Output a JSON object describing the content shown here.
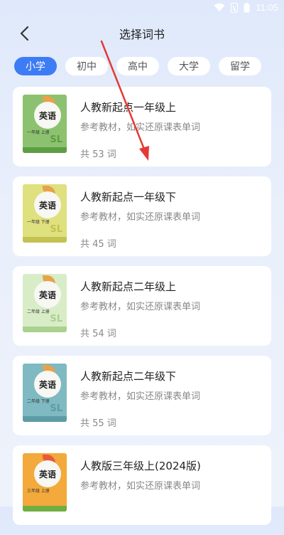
{
  "status_bar": {
    "time": "11:05"
  },
  "header": {
    "title": "选择词书"
  },
  "tabs": [
    {
      "label": "小学",
      "active": true
    },
    {
      "label": "初中",
      "active": false
    },
    {
      "label": "高中",
      "active": false
    },
    {
      "label": "大学",
      "active": false
    },
    {
      "label": "留学",
      "active": false
    }
  ],
  "books": [
    {
      "name": "人教新起点一年级上",
      "desc": "参考教材，如实还原课表单词",
      "count": "共 53 词",
      "cover_label": "英语",
      "cover_grade": "一年级 上册",
      "cover_sl": "SL",
      "cover_color": "#8cc26f",
      "cover_band": "#5d9e43",
      "cover_leaf": "#e8a24a"
    },
    {
      "name": "人教新起点一年级下",
      "desc": "参考教材，如实还原课表单词",
      "count": "共 45 词",
      "cover_label": "英语",
      "cover_grade": "一年级 下册",
      "cover_sl": "SL",
      "cover_color": "#dfe07e",
      "cover_band": "#c4c251",
      "cover_leaf": "#e8a24a"
    },
    {
      "name": "人教新起点二年级上",
      "desc": "参考教材，如实还原课表单词",
      "count": "共 54 词",
      "cover_label": "英语",
      "cover_grade": "二年级 上册",
      "cover_sl": "SL",
      "cover_color": "#d8edc7",
      "cover_band": "#a9d18f",
      "cover_leaf": "#e8a24a"
    },
    {
      "name": "人教新起点二年级下",
      "desc": "参考教材，如实还原课表单词",
      "count": "共 55 词",
      "cover_label": "英语",
      "cover_grade": "二年级 下册",
      "cover_sl": "SL",
      "cover_color": "#7fb9c2",
      "cover_band": "#5c9ca6",
      "cover_leaf": "#e8a24a"
    },
    {
      "name": "人教版三年级上(2024版)",
      "desc": "参考教材，如实还原课表单词",
      "count": "",
      "cover_label": "英语",
      "cover_grade": "三年级 上册",
      "cover_sl": "",
      "cover_color": "#f3a93b",
      "cover_band": "#6fae3f",
      "cover_leaf": "#e85a3a"
    }
  ],
  "colors": {
    "accent": "#3d7cf5",
    "annotation_arrow": "#e53935"
  }
}
